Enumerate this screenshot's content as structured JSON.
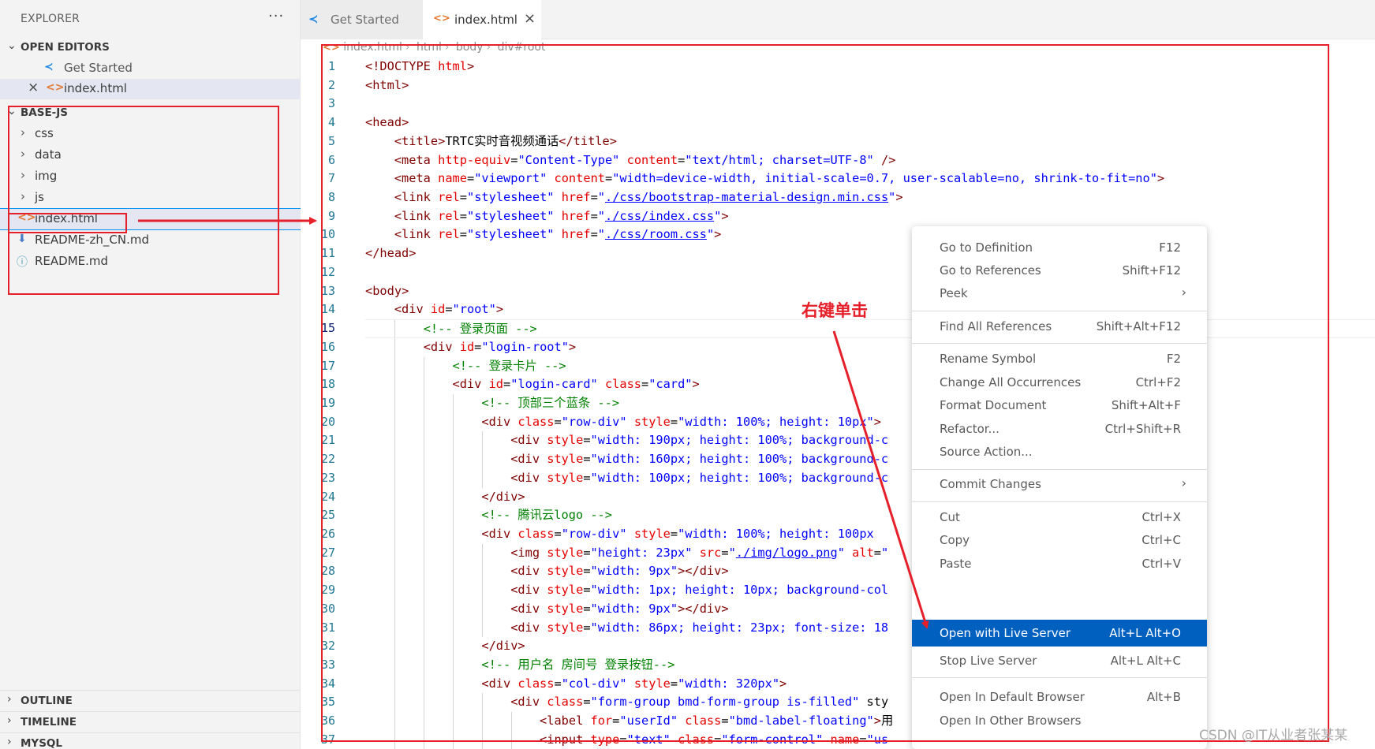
{
  "sidebar": {
    "title": "EXPLORER",
    "more": "···",
    "open_editors": {
      "label": "OPEN EDITORS",
      "items": [
        {
          "label": "Get Started",
          "icon": "vscode-icon"
        },
        {
          "label": "index.html",
          "icon": "html-icon",
          "close": "×"
        }
      ]
    },
    "project": {
      "label": "BASE-JS",
      "items": [
        {
          "label": "css",
          "kind": "folder"
        },
        {
          "label": "data",
          "kind": "folder"
        },
        {
          "label": "img",
          "kind": "folder"
        },
        {
          "label": "js",
          "kind": "folder"
        },
        {
          "label": "index.html",
          "kind": "html"
        },
        {
          "label": "README-zh_CN.md",
          "kind": "download-md"
        },
        {
          "label": "README.md",
          "kind": "info-md"
        }
      ]
    },
    "outline": "OUTLINE",
    "timeline": "TIMELINE",
    "mysql": "MYSQL"
  },
  "tabs": [
    {
      "label": "Get Started",
      "active": false
    },
    {
      "label": "index.html",
      "active": true,
      "close": "×"
    }
  ],
  "breadcrumbs": [
    "index.html",
    "html",
    "body",
    "div#root"
  ],
  "editor": {
    "line_numbers": [
      "1",
      "2",
      "3",
      "4",
      "5",
      "6",
      "7",
      "8",
      "9",
      "10",
      "11",
      "12",
      "13",
      "14",
      "15",
      "16",
      "17",
      "18",
      "19",
      "20",
      "21",
      "22",
      "23",
      "24",
      "25",
      "26",
      "27",
      "28",
      "29",
      "30",
      "31",
      "32",
      "33",
      "34",
      "35",
      "36",
      "37"
    ],
    "current_line": "15",
    "code_lines": [
      "<!DOCTYPE html>",
      "<html>",
      "",
      "<head>",
      "    <title>TRTC实时音视频通话</title>",
      "    <meta http-equiv=\"Content-Type\" content=\"text/html; charset=UTF-8\" />",
      "    <meta name=\"viewport\" content=\"width=device-width, initial-scale=0.7, user-scalable=no, shrink-to-fit=no\">",
      "    <link rel=\"stylesheet\" href=\"./css/bootstrap-material-design.min.css\">",
      "    <link rel=\"stylesheet\" href=\"./css/index.css\">",
      "    <link rel=\"stylesheet\" href=\"./css/room.css\">",
      "</head>",
      "",
      "<body>",
      "    <div id=\"root\">",
      "        <!-- 登录页面 -->",
      "        <div id=\"login-root\">",
      "            <!-- 登录卡片 -->",
      "            <div id=\"login-card\" class=\"card\">",
      "                <!-- 顶部三个蓝条 -->",
      "                <div class=\"row-div\" style=\"width: 100%; height: 10px\">",
      "                    <div style=\"width: 190px; height: 100%; background-c",
      "                    <div style=\"width: 160px; height: 100%; background-c",
      "                    <div style=\"width: 100px; height: 100%; background-c",
      "                </div>",
      "                <!-- 腾讯云logo -->",
      "                <div class=\"row-div\" style=\"width: 100%; height: 100px",
      "                    <img style=\"height: 23px\" src=\"./img/logo.png\" alt=\"",
      "                    <div style=\"width: 9px\"></div>",
      "                    <div style=\"width: 1px; height: 10px; background-col",
      "                    <div style=\"width: 9px\"></div>",
      "                    <div style=\"width: 86px; height: 23px; font-size: 18",
      "                </div>",
      "                <!-- 用户名 房间号 登录按钮-->",
      "                <div class=\"col-div\" style=\"width: 320px\">",
      "                    <div class=\"form-group bmd-form-group is-filled\" sty",
      "                        <label for=\"userId\" class=\"bmd-label-floating\">用",
      "                        <input type=\"text\" class=\"form-control\" name=\"us"
    ]
  },
  "context_menu": {
    "items": [
      {
        "label": "Go to Definition",
        "key": "F12"
      },
      {
        "label": "Go to References",
        "key": "Shift+F12"
      },
      {
        "label": "Peek",
        "key": "",
        "submenu": "›"
      },
      {
        "label": "Find All References",
        "key": "Shift+Alt+F12"
      },
      {
        "label": "Rename Symbol",
        "key": "F2"
      },
      {
        "label": "Change All Occurrences",
        "key": "Ctrl+F2"
      },
      {
        "label": "Format Document",
        "key": "Shift+Alt+F"
      },
      {
        "label": "Refactor...",
        "key": "Ctrl+Shift+R"
      },
      {
        "label": "Source Action...",
        "key": ""
      },
      {
        "label": "Commit Changes",
        "key": "",
        "submenu": "›"
      },
      {
        "label": "Cut",
        "key": "Ctrl+X"
      },
      {
        "label": "Copy",
        "key": "Ctrl+C"
      },
      {
        "label": "Paste",
        "key": "Ctrl+V"
      },
      {
        "label": "Open with Live Server",
        "key": "Alt+L Alt+O",
        "highlighted": true
      },
      {
        "label": "Stop Live Server",
        "key": "Alt+L Alt+C"
      },
      {
        "label": "Open In Default Browser",
        "key": "Alt+B"
      },
      {
        "label": "Open In Other Browsers",
        "key": ""
      }
    ]
  },
  "annotation": {
    "text": "右键单击",
    "color": "#e5202a"
  },
  "watermark": "CSDN @IT从业者张某某",
  "colors": {
    "accent": "#0060c0",
    "annotation_red": "#e5202a",
    "sidebar_bg": "#f3f3f3"
  }
}
